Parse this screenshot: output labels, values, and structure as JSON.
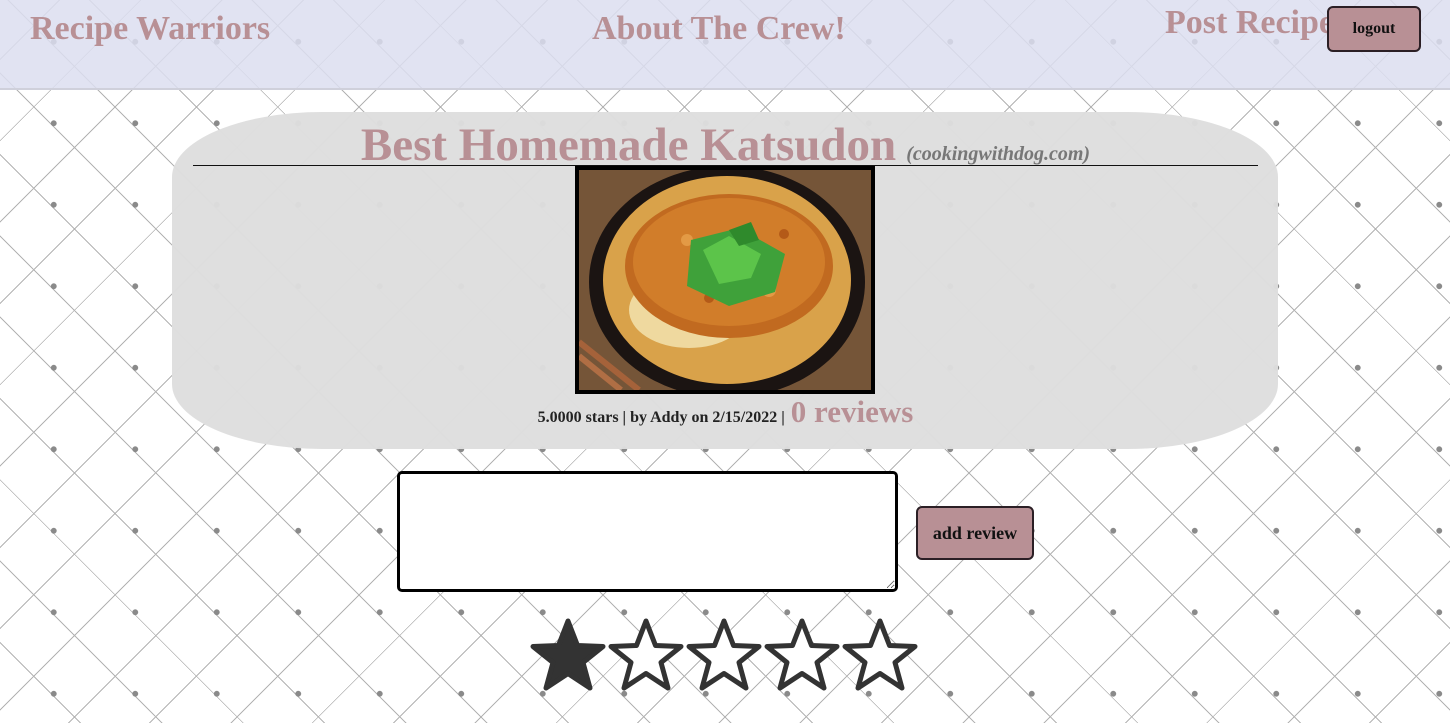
{
  "nav": {
    "brand": "Recipe Warriors",
    "about": "About The Crew!",
    "post": "Post Recipe",
    "logout": "logout"
  },
  "recipe": {
    "title": "Best Homemade Katsudon",
    "source": "(cookingwithdog.com)",
    "meta": "5.0000 stars | by Addy on 2/15/2022 |",
    "reviews": "0 reviews"
  },
  "review_form": {
    "text_value": "",
    "submit_label": "add review",
    "rating": 1,
    "max_rating": 5
  },
  "colors": {
    "accent": "#b89095",
    "star": "#333333",
    "card": "#dedede",
    "nav_bg": "#dcdef0"
  }
}
